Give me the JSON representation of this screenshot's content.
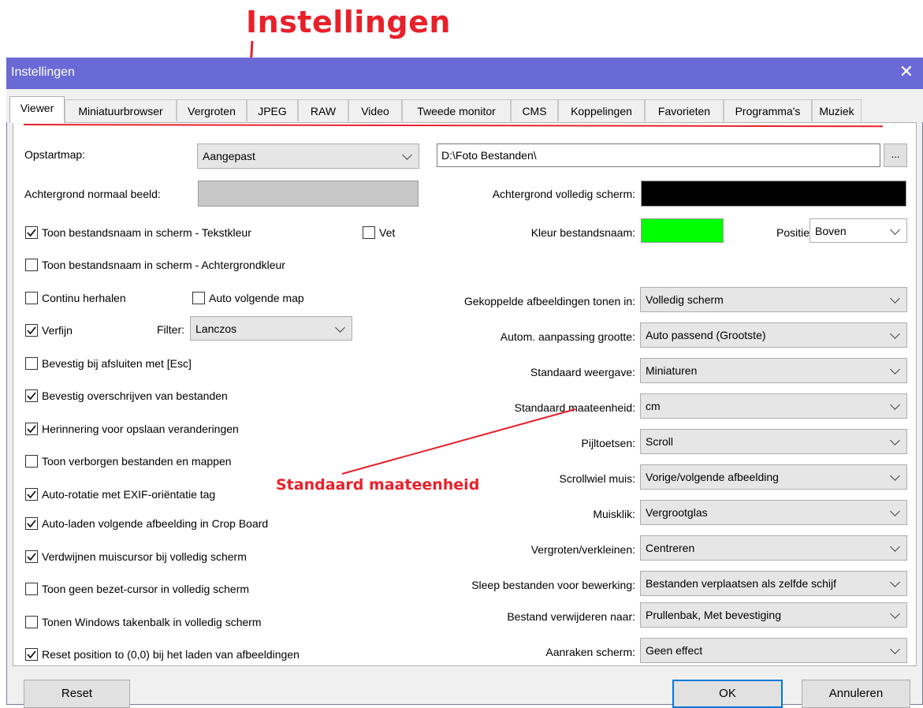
{
  "annotations": {
    "title": "Instellingen",
    "standard_unit": "Standaard maateenheid",
    "color": "#e8202a"
  },
  "window": {
    "title": "Instellingen",
    "close_glyph": "✕"
  },
  "tabs": [
    "Viewer",
    "Miniatuurbrowser",
    "Vergroten",
    "JPEG",
    "RAW",
    "Video",
    "Tweede monitor",
    "CMS",
    "Koppelingen",
    "Favorieten",
    "Programma's",
    "Muziek"
  ],
  "active_tab": "Viewer",
  "startup": {
    "label": "Opstartmap:",
    "mode": "Aangepast",
    "path": "D:\\Foto Bestanden\\",
    "browse": "..."
  },
  "bg_normal": {
    "label": "Achtergrond normaal beeld:",
    "color": "#c8c8c8"
  },
  "bg_full": {
    "label": "Achtergrond volledig scherm:",
    "color": "#000000"
  },
  "filename_color": {
    "label": "Kleur bestandsnaam:",
    "color": "#00ff00"
  },
  "position": {
    "label": "Positie:",
    "value": "Boven"
  },
  "filter": {
    "label": "Filter:",
    "value": "Lanczos"
  },
  "checkboxes": {
    "show_name_text": {
      "label": "Toon bestandsnaam in scherm - Tekstkleur",
      "checked": true
    },
    "bold": {
      "label": "Vet",
      "checked": false
    },
    "show_name_bg": {
      "label": "Toon bestandsnaam in scherm - Achtergrondkleur",
      "checked": false
    },
    "loop": {
      "label": "Continu herhalen",
      "checked": false
    },
    "auto_next_folder": {
      "label": "Auto volgende map",
      "checked": false
    },
    "refine": {
      "label": "Verfijn",
      "checked": true
    },
    "confirm_esc": {
      "label": "Bevestig bij afsluiten met [Esc]",
      "checked": false
    },
    "confirm_overwrite": {
      "label": "Bevestig overschrijven van bestanden",
      "checked": true
    },
    "remind_save": {
      "label": "Herinnering voor opslaan veranderingen",
      "checked": true
    },
    "show_hidden": {
      "label": "Toon verborgen bestanden en mappen",
      "checked": false
    },
    "auto_rotate": {
      "label": "Auto-rotatie met EXIF-oriëntatie tag",
      "checked": true
    },
    "auto_load_crop": {
      "label": "Auto-laden volgende afbeelding in Crop Board",
      "checked": true
    },
    "hide_cursor": {
      "label": "Verdwijnen muiscursor bij volledig scherm",
      "checked": true
    },
    "no_busy_cursor": {
      "label": "Toon geen bezet-cursor in volledig scherm",
      "checked": false
    },
    "show_taskbar": {
      "label": "Tonen Windows takenbalk in volledig scherm",
      "checked": false
    },
    "reset_position": {
      "label": "Reset position to (0,0) bij het laden van afbeeldingen",
      "checked": true
    }
  },
  "right_settings": [
    {
      "label": "Gekoppelde afbeeldingen tonen in:",
      "value": "Volledig scherm"
    },
    {
      "label": "Autom. aanpassing grootte:",
      "value": "Auto passend (Grootste)"
    },
    {
      "label": "Standaard weergave:",
      "value": "Miniaturen"
    },
    {
      "label": "Standaard maateenheid:",
      "value": "cm"
    },
    {
      "label": "Pijltoetsen:",
      "value": "Scroll"
    },
    {
      "label": "Scrollwiel muis:",
      "value": "Vorige/volgende afbeelding"
    },
    {
      "label": "Muisklik:",
      "value": "Vergrootglas"
    },
    {
      "label": "Vergroten/verkleinen:",
      "value": "Centreren"
    },
    {
      "label": "Sleep bestanden voor bewerking:",
      "value": "Bestanden verplaatsen als zelfde schijf"
    },
    {
      "label": "Bestand verwijderen naar:",
      "value": "Prullenbak, Met bevestiging"
    },
    {
      "label": "Aanraken scherm:",
      "value": "Geen effect"
    }
  ],
  "buttons": {
    "reset": "Reset",
    "ok": "OK",
    "cancel": "Annuleren"
  }
}
